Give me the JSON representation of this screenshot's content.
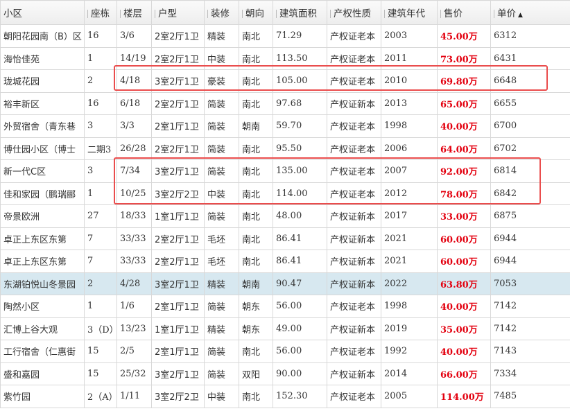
{
  "headers": [
    "小区",
    "座栋",
    "楼层",
    "户型",
    "装修",
    "朝向",
    "建筑面积",
    "产权性质",
    "建筑年代",
    "售价",
    "单价"
  ],
  "sort_indicator": "▲",
  "rows": [
    [
      "朝阳花园南（B）区",
      "16",
      "3/6",
      "2室2厅1卫",
      "精装",
      "南北",
      "71.29",
      "产权证老本",
      "2003",
      "45.00万",
      "6312"
    ],
    [
      "海怡佳苑",
      "1",
      "14/19",
      "2室2厅1卫",
      "中装",
      "南北",
      "113.50",
      "产权证老本",
      "2011",
      "73.00万",
      "6431"
    ],
    [
      "珑城花园",
      "2",
      "4/18",
      "3室2厅1卫",
      "豪装",
      "南北",
      "105.00",
      "产权证老本",
      "2010",
      "69.80万",
      "6648"
    ],
    [
      "裕丰新区",
      "16",
      "6/18",
      "2室2厅1卫",
      "简装",
      "南北",
      "97.68",
      "产权证新本",
      "2013",
      "65.00万",
      "6655"
    ],
    [
      "外贸宿舍（青东巷",
      "3",
      "3/3",
      "2室1厅1卫",
      "简装",
      "朝南",
      "59.70",
      "产权证老本",
      "1998",
      "40.00万",
      "6700"
    ],
    [
      "博仕园小区（博士",
      "二期3",
      "26/28",
      "2室2厅1卫",
      "简装",
      "南北",
      "95.50",
      "产权证老本",
      "2006",
      "64.00万",
      "6702"
    ],
    [
      "新一代C区",
      "3",
      "7/34",
      "3室2厅1卫",
      "简装",
      "南北",
      "135.00",
      "产权证老本",
      "2007",
      "92.00万",
      "6814"
    ],
    [
      "佳和家园（鹏瑞郦",
      "1",
      "10/25",
      "3室2厅2卫",
      "中装",
      "南北",
      "114.00",
      "产权证老本",
      "2012",
      "78.00万",
      "6842"
    ],
    [
      "帝景欧洲",
      "27",
      "18/33",
      "1室1厅1卫",
      "简装",
      "南北",
      "48.00",
      "产权证新本",
      "2017",
      "33.00万",
      "6875"
    ],
    [
      "卓正上东区东第",
      "7",
      "33/33",
      "2室2厅1卫",
      "毛坯",
      "南北",
      "86.41",
      "产权证新本",
      "2021",
      "60.00万",
      "6944"
    ],
    [
      "卓正上东区东第",
      "7",
      "33/33",
      "2室2厅1卫",
      "毛坯",
      "南北",
      "86.41",
      "产权证新本",
      "2021",
      "60.00万",
      "6944"
    ],
    [
      "东湖铂悦山冬景园",
      "2",
      "4/28",
      "3室2厅1卫",
      "精装",
      "朝南",
      "90.47",
      "产权证新本",
      "2022",
      "63.80万",
      "7053"
    ],
    [
      "陶然小区",
      "1",
      "1/6",
      "2室1厅1卫",
      "简装",
      "朝东",
      "56.00",
      "产权证老本",
      "1998",
      "40.00万",
      "7142"
    ],
    [
      "汇博上谷大观",
      "3（D）",
      "13/23",
      "1室1厅1卫",
      "精装",
      "朝东",
      "49.00",
      "产权证新本",
      "2019",
      "35.00万",
      "7142"
    ],
    [
      "工行宿舍（仁惠街",
      "15",
      "2/5",
      "2室1厅1卫",
      "简装",
      "南北",
      "56.00",
      "产权证老本",
      "1992",
      "40.00万",
      "7143"
    ],
    [
      "盛和嘉园",
      "15",
      "25/32",
      "3室2厅1卫",
      "简装",
      "双阳",
      "90.00",
      "产权证新本",
      "2014",
      "66.00万",
      "7334"
    ],
    [
      "紫竹园",
      "2（A）",
      "1/11",
      "3室2厅2卫",
      "中装",
      "南北",
      "152.30",
      "产权证老本",
      "2005",
      "114.00万",
      "7485"
    ]
  ],
  "highlighted_row": 11,
  "colors": {
    "highlight_row": "#d7e8f0",
    "price": "#e3000f",
    "annotation_box": "#ea4d4d"
  }
}
